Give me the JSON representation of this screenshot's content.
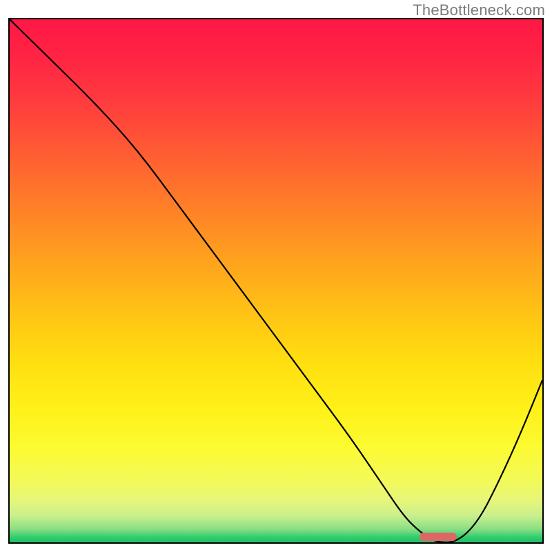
{
  "watermark": "TheBottleneck.com",
  "chart_data": {
    "type": "line",
    "title": "",
    "xlabel": "",
    "ylabel": "",
    "xlim": [
      0,
      100
    ],
    "ylim": [
      0,
      100
    ],
    "grid": false,
    "series": [
      {
        "name": "bottleneck-curve",
        "x": [
          0,
          6,
          16,
          24,
          32,
          40,
          48,
          56,
          64,
          70,
          74,
          77,
          80,
          84,
          88,
          92,
          96,
          100
        ],
        "values": [
          100,
          94,
          84,
          75,
          64,
          53,
          42,
          31,
          20,
          11,
          5,
          2,
          0,
          0,
          4,
          12,
          21,
          31
        ]
      }
    ],
    "marker": {
      "x_start": 77,
      "x_end": 84,
      "y": 0,
      "color": "#e06666"
    },
    "background_gradient": {
      "stops": [
        {
          "pos": 0.0,
          "color": "#ff1846"
        },
        {
          "pos": 0.07,
          "color": "#ff2444"
        },
        {
          "pos": 0.15,
          "color": "#ff3a3f"
        },
        {
          "pos": 0.25,
          "color": "#ff5b34"
        },
        {
          "pos": 0.35,
          "color": "#ff7d29"
        },
        {
          "pos": 0.45,
          "color": "#ff9f1f"
        },
        {
          "pos": 0.55,
          "color": "#ffc016"
        },
        {
          "pos": 0.65,
          "color": "#ffde10"
        },
        {
          "pos": 0.75,
          "color": "#fff21a"
        },
        {
          "pos": 0.82,
          "color": "#fcfb33"
        },
        {
          "pos": 0.88,
          "color": "#f4fa58"
        },
        {
          "pos": 0.92,
          "color": "#e6f77a"
        },
        {
          "pos": 0.95,
          "color": "#c9ef8e"
        },
        {
          "pos": 0.975,
          "color": "#88df84"
        },
        {
          "pos": 0.99,
          "color": "#32cd6e"
        },
        {
          "pos": 1.0,
          "color": "#1fc264"
        }
      ]
    }
  }
}
